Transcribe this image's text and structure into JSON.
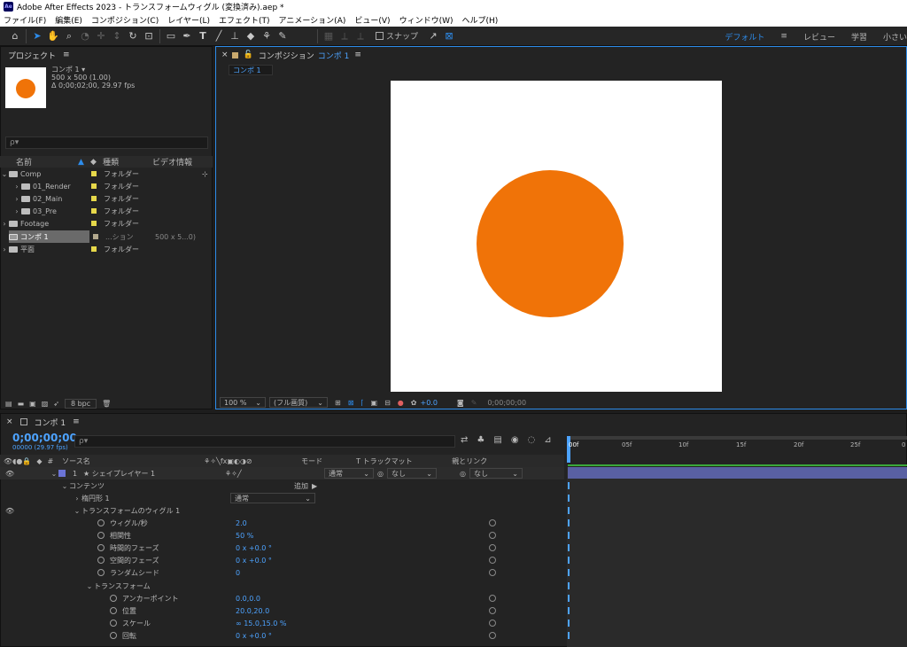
{
  "window": {
    "title": "Adobe After Effects 2023 - トランスフォームウィグル (変換済み).aep *",
    "logo": "Ae"
  },
  "menu": [
    "ファイル(F)",
    "編集(E)",
    "コンポジション(C)",
    "レイヤー(L)",
    "エフェクト(T)",
    "アニメーション(A)",
    "ビュー(V)",
    "ウィンドウ(W)",
    "ヘルプ(H)"
  ],
  "toolbar": {
    "snap_label": "スナップ",
    "workspaces": [
      "デフォルト",
      "レビュー",
      "学習",
      "小さい"
    ]
  },
  "project": {
    "tab": "プロジェクト",
    "comp_name": "コンポ 1 ▾",
    "comp_size": "500 x 500 (1.00)",
    "comp_dur": "Δ 0;00;02;00, 29.97 fps",
    "search_placeholder": "ρ▾",
    "col_name": "名前",
    "col_type": "種類",
    "col_video": "ビデオ情報",
    "items": [
      {
        "name": "Comp",
        "type": "フォルダー",
        "info": ""
      },
      {
        "name": "01_Render",
        "type": "フォルダー",
        "info": ""
      },
      {
        "name": "02_Main",
        "type": "フォルダー",
        "info": ""
      },
      {
        "name": "03_Pre",
        "type": "フォルダー",
        "info": ""
      },
      {
        "name": "Footage",
        "type": "フォルダー",
        "info": ""
      },
      {
        "name": "コンポ 1",
        "type": "...ション",
        "info": "500 x 5...0)"
      },
      {
        "name": "平面",
        "type": "フォルダー",
        "info": ""
      }
    ],
    "bpc": "8 bpc"
  },
  "viewer": {
    "tab_prefix": "コンポジション",
    "tab_name": "コンポ 1",
    "subtab": "コンポ 1",
    "zoom": "100 %",
    "quality": "(フル画質)",
    "exposure": "+0.0",
    "timecode": "0;00;00;00",
    "circle_color": "#f07308"
  },
  "timeline": {
    "tab": "コンポ 1",
    "timecode": "0;00;00;00",
    "fps": "00000 (29.97 fps)",
    "search_placeholder": "ρ▾",
    "headers": {
      "source": "ソース名",
      "mode": "モード",
      "trackmatte": "T  トラックマット",
      "parent": "親とリンク"
    },
    "ruler": [
      "00f",
      "05f",
      "10f",
      "15f",
      "20f",
      "25f",
      "0"
    ],
    "layer": {
      "num": "1",
      "name": "★ シェイプレイヤー 1",
      "mode": "通常",
      "matte": "なし",
      "parent": "なし"
    },
    "contents": "コンテンツ",
    "add_label": "追加",
    "ellipse": "楕円形 1",
    "ellipse_mode": "通常",
    "wiggle": "トランスフォームのウィグル 1",
    "props": [
      {
        "label": "ウィグル/秒",
        "value": "2.0"
      },
      {
        "label": "相関性",
        "value": "50 %"
      },
      {
        "label": "時間的フェーズ",
        "value": "0 x +0.0 °"
      },
      {
        "label": "空間的フェーズ",
        "value": "0 x +0.0 °"
      },
      {
        "label": "ランダムシード",
        "value": "0"
      }
    ],
    "transform": "トランスフォーム",
    "tprops": [
      {
        "label": "アンカーポイント",
        "value": "0.0,0.0"
      },
      {
        "label": "位置",
        "value": "20.0,20.0"
      },
      {
        "label": "スケール",
        "value": "∞ 15.0,15.0 %"
      },
      {
        "label": "回転",
        "value": "0 x +0.0 °"
      }
    ]
  }
}
